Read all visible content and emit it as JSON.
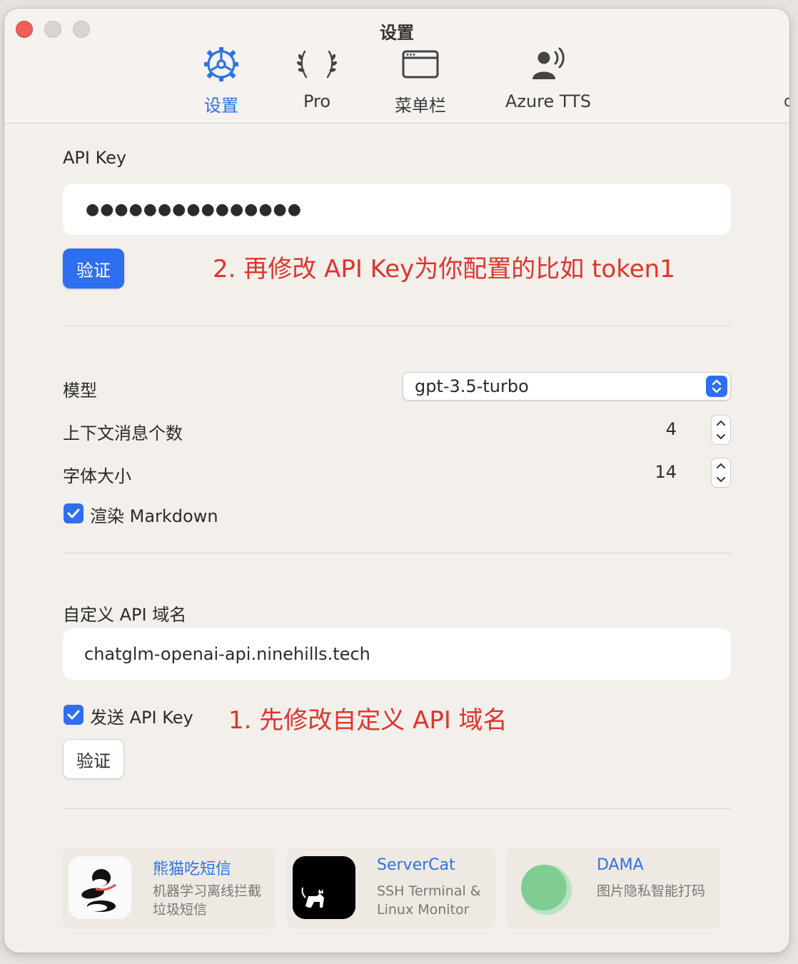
{
  "window": {
    "title": "设置"
  },
  "tabs": [
    {
      "label": "设置",
      "icon": "settings-gear-icon",
      "active": true
    },
    {
      "label": "Pro",
      "icon": "laurel-wreath-icon",
      "active": false
    },
    {
      "label": "菜单栏",
      "icon": "menubar-window-icon",
      "active": false
    },
    {
      "label": "Azure TTS",
      "icon": "speaking-person-icon",
      "active": false
    }
  ],
  "api_key": {
    "label": "API Key",
    "value": "●●●●●●●●●●●●●●●",
    "verify_label": "验证",
    "annotation": "2. 再修改 API Key为你配置的比如 token1"
  },
  "model": {
    "label": "模型",
    "selected": "gpt-3.5-turbo"
  },
  "context_count": {
    "label": "上下文消息个数",
    "value": "4"
  },
  "font_size": {
    "label": "字体大小",
    "value": "14"
  },
  "render_markdown": {
    "label": "渲染 Markdown",
    "checked": true
  },
  "custom_domain": {
    "label": "自定义 API 域名",
    "value": "chatglm-openai-api.ninehills.tech",
    "send_key_label": "发送 API Key",
    "send_key_checked": true,
    "annotation": "1. 先修改自定义 API 域名",
    "verify_label": "验证"
  },
  "promos": [
    {
      "title": "熊猫吃短信",
      "desc_line1": "机器学习离线拦截",
      "desc_line2": "垃圾短信",
      "icon": "panda-icon"
    },
    {
      "title": "ServerCat",
      "desc_line1": "SSH Terminal &",
      "desc_line2": "Linux Monitor",
      "icon": "cat-icon"
    },
    {
      "title": "DAMA",
      "desc_line1": "图片隐私智能打码",
      "desc_line2": "",
      "icon": "green-circle-icon"
    }
  ],
  "colors": {
    "accent": "#2e6ff0",
    "annotation": "#e0342c",
    "link": "#2d72e6"
  }
}
